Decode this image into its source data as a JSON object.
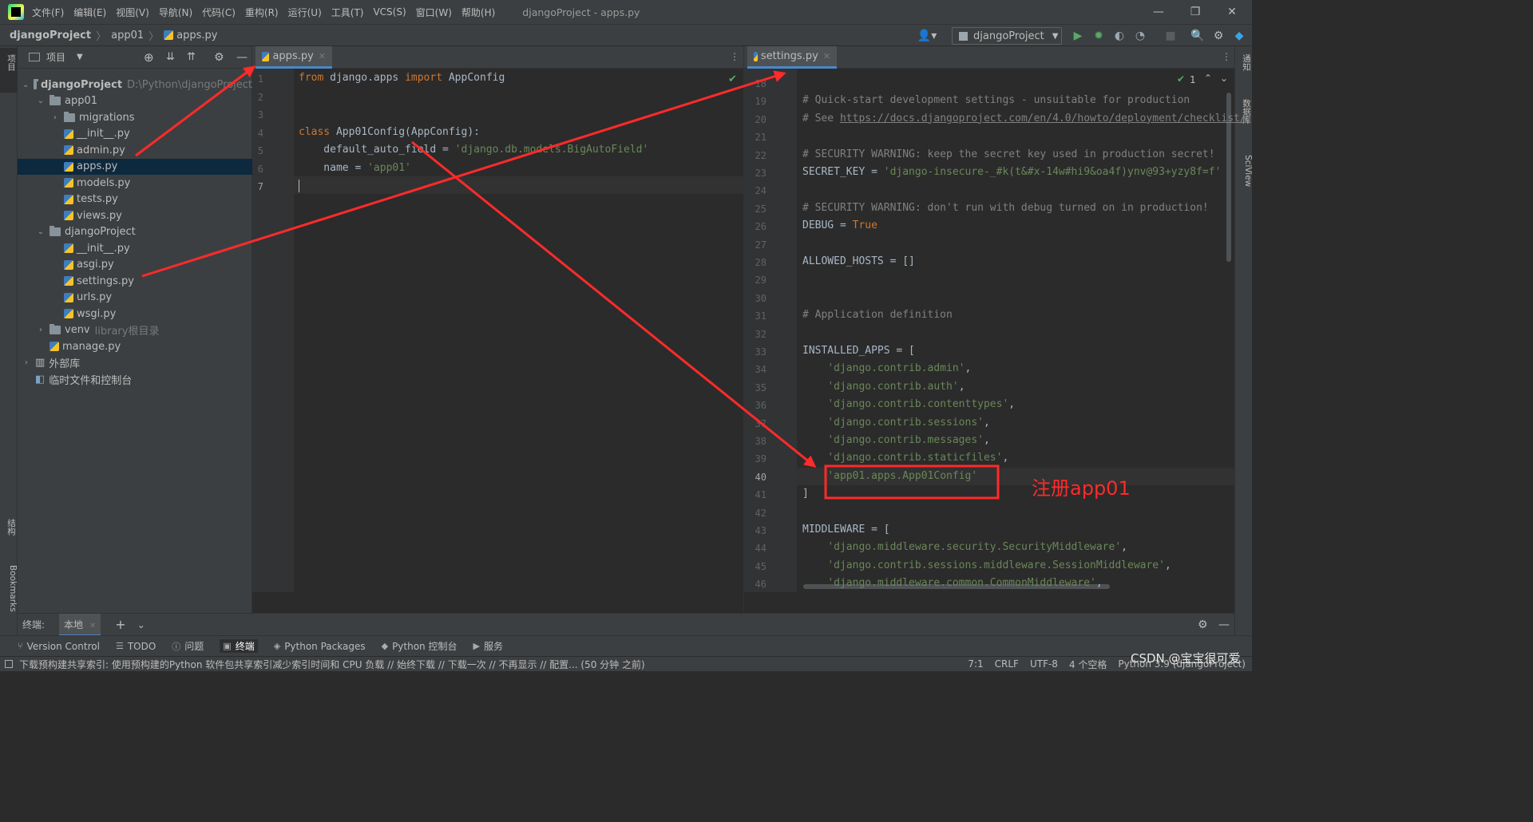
{
  "app": {
    "window_title": "djangoProject - apps.py",
    "menu": [
      "文件(F)",
      "编辑(E)",
      "视图(V)",
      "导航(N)",
      "代码(C)",
      "重构(R)",
      "运行(U)",
      "工具(T)",
      "VCS(S)",
      "窗口(W)",
      "帮助(H)"
    ]
  },
  "navbar": {
    "crumbs": [
      "djangoProject",
      "app01",
      "apps.py"
    ],
    "run_config": "djangoProject"
  },
  "left_strip": {
    "top_tab": "项目",
    "structure_tab": "结构",
    "bookmarks_tab": "Bookmarks"
  },
  "right_strip": {
    "tabs": [
      "通知",
      "数据库",
      "SciView"
    ]
  },
  "project": {
    "header_label": "项目",
    "tree": [
      {
        "label": "djangoProject",
        "hint": "D:\\Python\\djangoProject",
        "kind": "folder",
        "depth": 0,
        "chev": "v"
      },
      {
        "label": "app01",
        "hint": "",
        "kind": "folder",
        "depth": 1,
        "chev": "v"
      },
      {
        "label": "migrations",
        "hint": "",
        "kind": "folder",
        "depth": 2,
        "chev": ">"
      },
      {
        "label": "__init__.py",
        "hint": "",
        "kind": "py",
        "depth": 2,
        "chev": ""
      },
      {
        "label": "admin.py",
        "hint": "",
        "kind": "py",
        "depth": 2,
        "chev": ""
      },
      {
        "label": "apps.py",
        "hint": "",
        "kind": "py",
        "depth": 2,
        "chev": "",
        "selected": true
      },
      {
        "label": "models.py",
        "hint": "",
        "kind": "py",
        "depth": 2,
        "chev": ""
      },
      {
        "label": "tests.py",
        "hint": "",
        "kind": "py",
        "depth": 2,
        "chev": ""
      },
      {
        "label": "views.py",
        "hint": "",
        "kind": "py",
        "depth": 2,
        "chev": ""
      },
      {
        "label": "djangoProject",
        "hint": "",
        "kind": "folder",
        "depth": 1,
        "chev": "v"
      },
      {
        "label": "__init__.py",
        "hint": "",
        "kind": "py",
        "depth": 2,
        "chev": ""
      },
      {
        "label": "asgi.py",
        "hint": "",
        "kind": "py",
        "depth": 2,
        "chev": ""
      },
      {
        "label": "settings.py",
        "hint": "",
        "kind": "py",
        "depth": 2,
        "chev": ""
      },
      {
        "label": "urls.py",
        "hint": "",
        "kind": "py",
        "depth": 2,
        "chev": ""
      },
      {
        "label": "wsgi.py",
        "hint": "",
        "kind": "py",
        "depth": 2,
        "chev": ""
      },
      {
        "label": "venv",
        "hint": "library根目录",
        "kind": "folder",
        "depth": 1,
        "chev": ">"
      },
      {
        "label": "manage.py",
        "hint": "",
        "kind": "py",
        "depth": 1,
        "chev": ""
      },
      {
        "label": "外部库",
        "hint": "",
        "kind": "lib",
        "depth": 0,
        "chev": ">"
      },
      {
        "label": "临时文件和控制台",
        "hint": "",
        "kind": "scratch",
        "depth": 0,
        "chev": ""
      }
    ]
  },
  "editor_left": {
    "tab": "apps.py",
    "lines": [
      {
        "n": "1",
        "html": "<span class='kw'>from</span> django.apps <span class='kw'>import</span> AppConfig"
      },
      {
        "n": "2",
        "html": ""
      },
      {
        "n": "3",
        "html": ""
      },
      {
        "n": "4",
        "html": "<span class='kw'>class</span> App01Config(AppConfig):"
      },
      {
        "n": "5",
        "html": "    default_auto_field = <span class='str'>'django.db.models.BigAutoField'</span>"
      },
      {
        "n": "6",
        "html": "    name = <span class='str'>'app01'</span>"
      },
      {
        "n": "7",
        "html": ""
      }
    ]
  },
  "editor_right": {
    "tab": "settings.py",
    "inspection_count": "1",
    "lines": [
      {
        "n": "18",
        "html": ""
      },
      {
        "n": "19",
        "html": "<span class='cmt'># Quick-start development settings - unsuitable for production</span>"
      },
      {
        "n": "20",
        "html": "<span class='cmt'># See <span class='link'>https://docs.djangoproject.com/en/4.0/howto/deployment/checklist/</span></span>"
      },
      {
        "n": "21",
        "html": ""
      },
      {
        "n": "22",
        "html": "<span class='cmt'># SECURITY WARNING: keep the secret key used in production secret!</span>"
      },
      {
        "n": "23",
        "html": "SECRET_KEY = <span class='str'>'django-insecure-_#k(t&amp;#x-14w#hi9&amp;oa4f)ynv@93+yzy8f=f'</span>"
      },
      {
        "n": "24",
        "html": ""
      },
      {
        "n": "25",
        "html": "<span class='cmt'># SECURITY WARNING: don't run with debug turned on in production!</span>"
      },
      {
        "n": "26",
        "html": "DEBUG = <span class='kw'>True</span>"
      },
      {
        "n": "27",
        "html": ""
      },
      {
        "n": "28",
        "html": "ALLOWED_HOSTS = []"
      },
      {
        "n": "29",
        "html": ""
      },
      {
        "n": "30",
        "html": ""
      },
      {
        "n": "31",
        "html": "<span class='cmt'># Application definition</span>"
      },
      {
        "n": "32",
        "html": ""
      },
      {
        "n": "33",
        "html": "INSTALLED_APPS = ["
      },
      {
        "n": "34",
        "html": "    <span class='str'>'django.contrib.admin'</span>,"
      },
      {
        "n": "35",
        "html": "    <span class='str'>'django.contrib.auth'</span>,"
      },
      {
        "n": "36",
        "html": "    <span class='str'>'django.contrib.contenttypes'</span>,"
      },
      {
        "n": "37",
        "html": "    <span class='str'>'django.contrib.sessions'</span>,"
      },
      {
        "n": "38",
        "html": "    <span class='str'>'django.contrib.messages'</span>,"
      },
      {
        "n": "39",
        "html": "    <span class='str'>'django.contrib.staticfiles'</span>,"
      },
      {
        "n": "40",
        "html": "    <span class='str'>'app01.apps.App01Config'</span>"
      },
      {
        "n": "41",
        "html": "]"
      },
      {
        "n": "42",
        "html": ""
      },
      {
        "n": "43",
        "html": "MIDDLEWARE = ["
      },
      {
        "n": "44",
        "html": "    <span class='str'>'django.middleware.security.SecurityMiddleware'</span>,"
      },
      {
        "n": "45",
        "html": "    <span class='str'>'django.contrib.sessions.middleware.SessionMiddleware'</span>,"
      },
      {
        "n": "46",
        "html": "    <span class='str'>'django.middleware.common.CommonMiddleware'</span>,"
      }
    ]
  },
  "annotation": {
    "label": "注册app01",
    "color": "#ff2a2a"
  },
  "terminal": {
    "label": "终端:",
    "tab": "本地"
  },
  "toolwindows": [
    "Version Control",
    "TODO",
    "问题",
    "终端",
    "Python Packages",
    "Python 控制台",
    "服务"
  ],
  "status": {
    "message": "下载预构建共享索引: 使用预构建的Python 软件包共享索引减少索引时间和 CPU 负载 // 始终下载 // 下载一次 // 不再显示 // 配置... (50 分钟 之前)",
    "position": "7:1",
    "line_sep": "CRLF",
    "encoding": "UTF-8",
    "indent": "4 个空格",
    "interpreter": "Python 3.9 (djangoProject)",
    "watermark": "CSDN @宝宝很可爱"
  }
}
